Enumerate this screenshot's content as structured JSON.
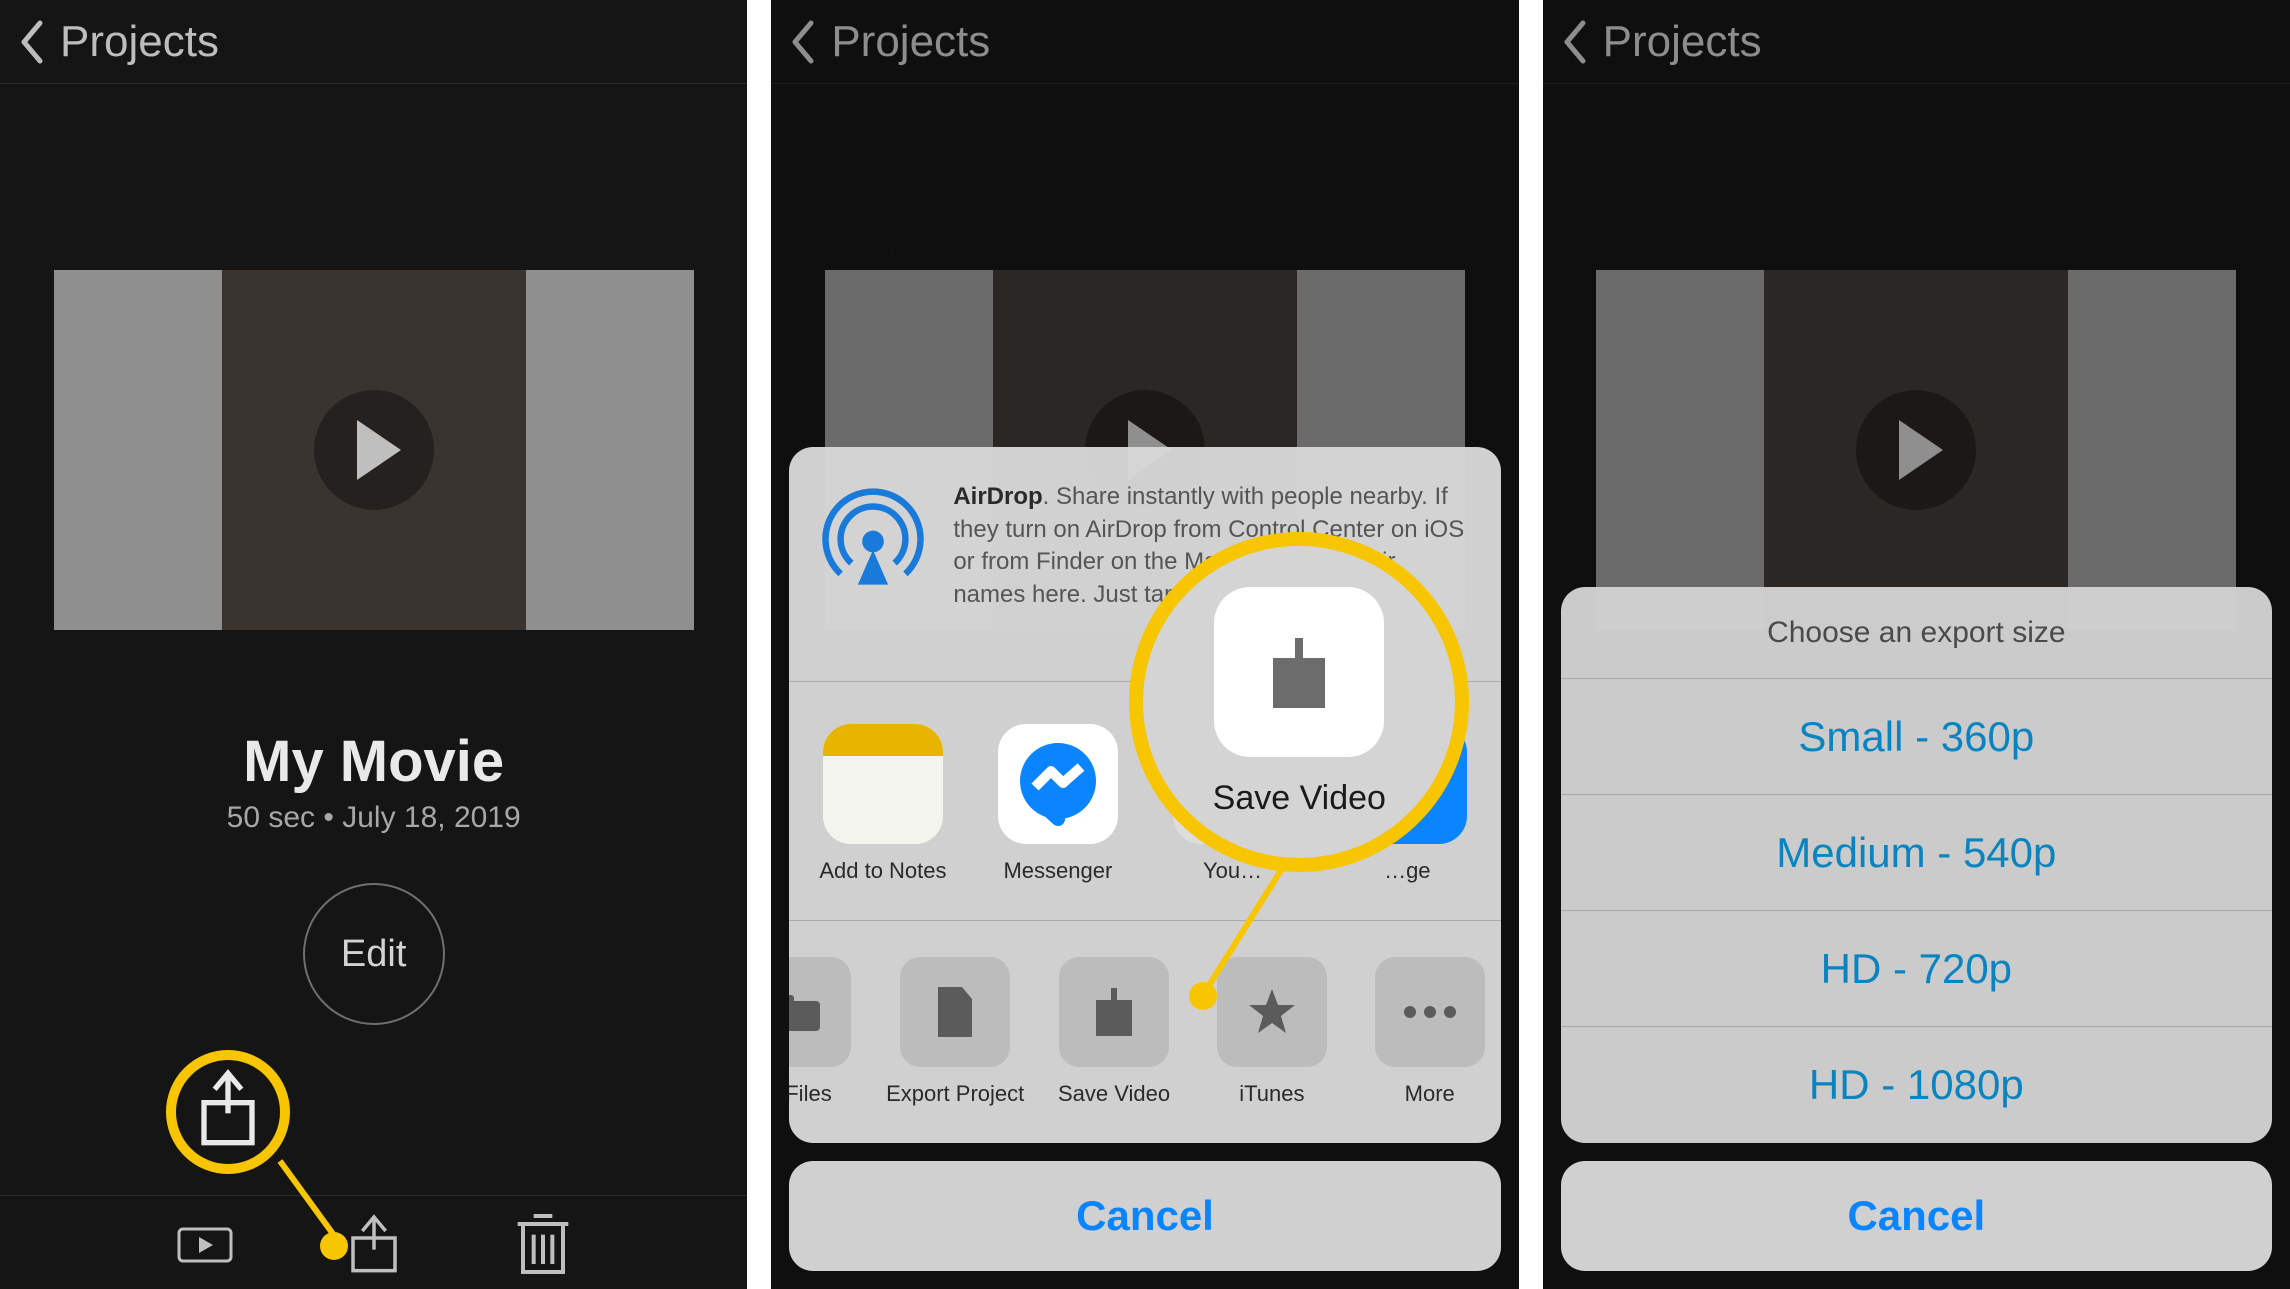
{
  "nav": {
    "label": "Projects"
  },
  "project": {
    "title": "My Movie",
    "duration": "50 sec",
    "date": "July 18, 2019",
    "edit_label": "Edit"
  },
  "share_sheet": {
    "airdrop": {
      "title": "AirDrop",
      "body": ". Share instantly with people nearby. If they turn on AirDrop from Control Center on iOS or from Finder on the Mac, you'll see their names here. Just tap to share."
    },
    "apps": [
      {
        "label": "Add to Notes",
        "icon": "notes"
      },
      {
        "label": "Messenger",
        "icon": "messenger"
      },
      {
        "label": "You…",
        "icon": "youtube-partial"
      },
      {
        "label": "…ge",
        "icon": "partial"
      }
    ],
    "actions": [
      {
        "label": "to Files",
        "icon": "folder"
      },
      {
        "label": "Export Project",
        "icon": "file"
      },
      {
        "label": "Save Video",
        "icon": "download"
      },
      {
        "label": "iTunes",
        "icon": "star"
      },
      {
        "label": "More",
        "icon": "dots"
      }
    ],
    "cancel": "Cancel"
  },
  "callout": {
    "save_video_label": "Save Video"
  },
  "export": {
    "title": "Choose an export size",
    "options": [
      "Small - 360p",
      "Medium - 540p",
      "HD - 720p",
      "HD - 1080p"
    ],
    "cancel": "Cancel"
  }
}
